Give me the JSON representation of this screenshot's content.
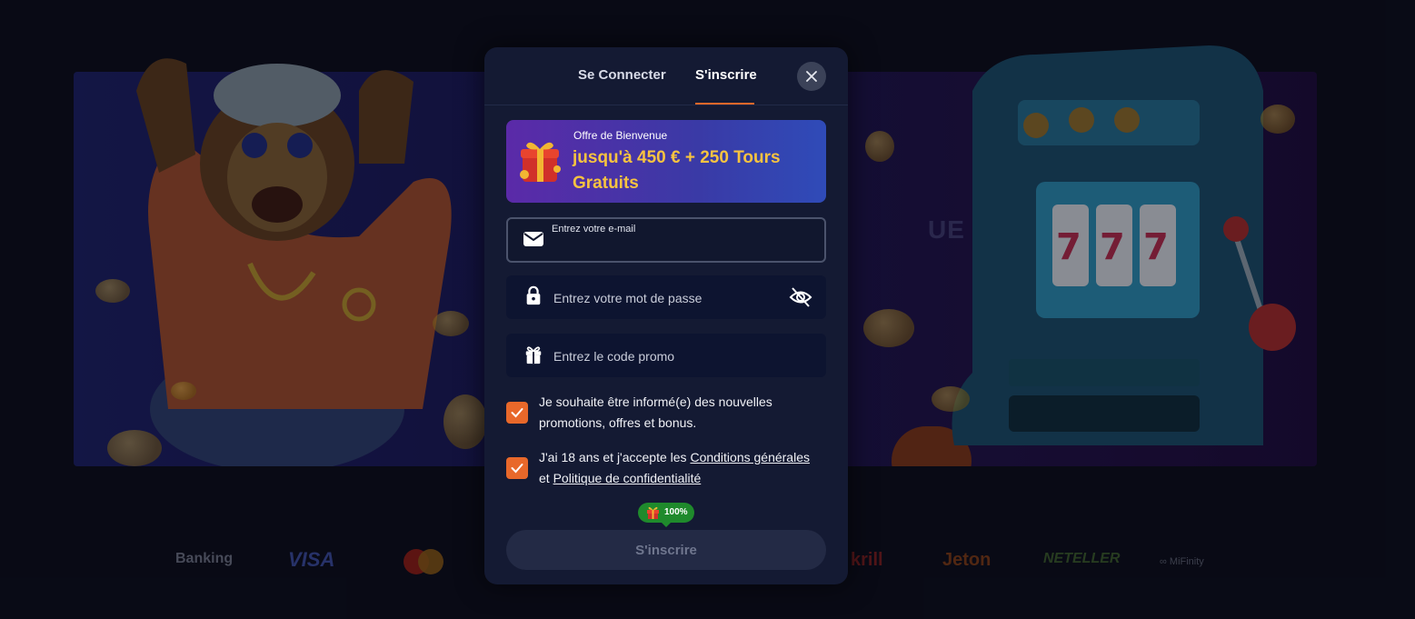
{
  "background": {
    "hero_title_fragment": "UE",
    "payments": {
      "label": "Banking",
      "visa": "VISA",
      "skrill": "krill",
      "jeton": "Jeton",
      "neteller": "NETELLER",
      "mifinity": "MiFinity"
    }
  },
  "modal": {
    "tabs": [
      {
        "label": "Se Connecter",
        "active": false
      },
      {
        "label": "S'inscrire",
        "active": true
      }
    ],
    "banner": {
      "small": "Offre de Bienvenue",
      "big": "jusqu'à 450 € + 250 Tours Gratuits"
    },
    "email": {
      "label": "Entrez votre e-mail",
      "value": ""
    },
    "password": {
      "placeholder": "Entrez votre mot de passe"
    },
    "promo": {
      "placeholder": "Entrez le code promo"
    },
    "newsletter": {
      "checked": true,
      "text": "Je souhaite être informé(e) des nouvelles promotions, offres et bonus."
    },
    "terms": {
      "checked": true,
      "prefix": "J'ai 18 ans et j'accepte les ",
      "link1": "Conditions générales",
      "middle": " et ",
      "link2": "Politique de confidentialité"
    },
    "badge": "100%",
    "submit_label": "S'inscrire"
  },
  "colors": {
    "accent": "#e8682a",
    "modal_bg": "#141a33",
    "banner_text": "#f7c340",
    "badge": "#1f8a2c"
  }
}
